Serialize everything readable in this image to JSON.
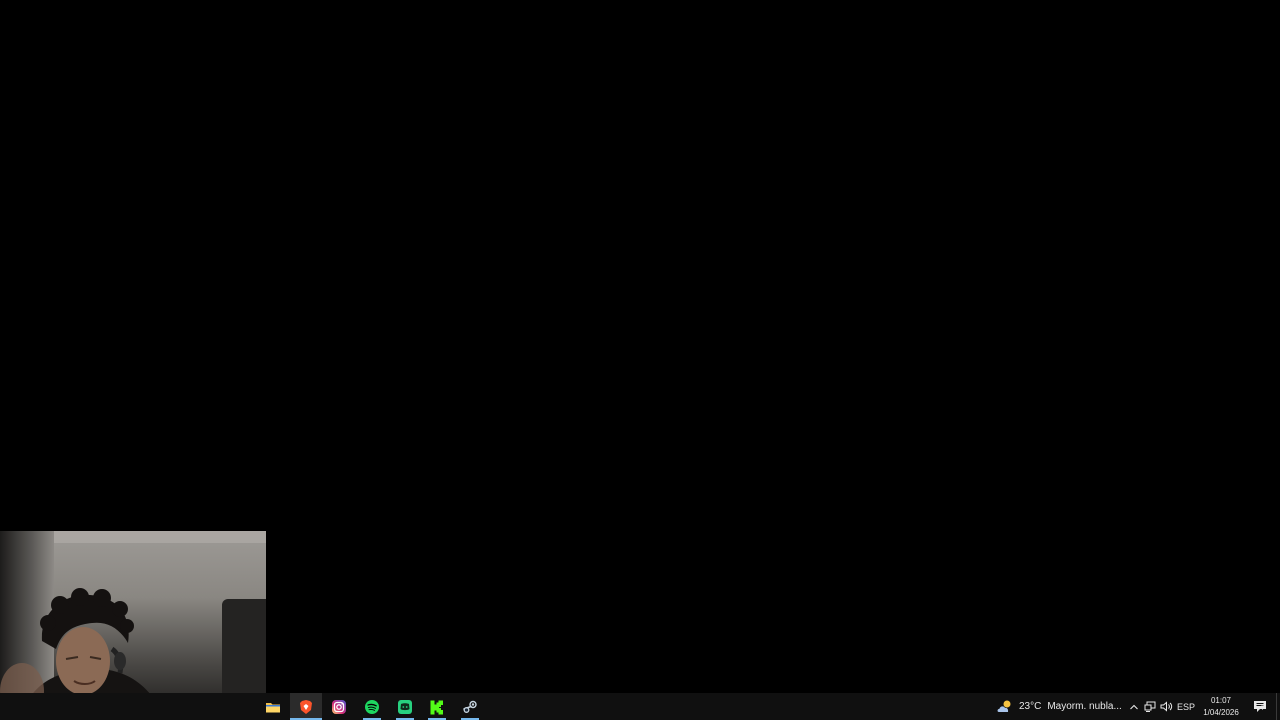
{
  "taskbar": {
    "apps": [
      {
        "name": "File Explorer",
        "icon": "folder-icon",
        "color": "#f3c04b"
      },
      {
        "name": "Brave",
        "icon": "brave-icon",
        "color": "#fb542b"
      },
      {
        "name": "Instagram",
        "icon": "instagram-icon",
        "color": "#d6249f"
      },
      {
        "name": "Spotify",
        "icon": "spotify-icon",
        "color": "#1ed760"
      },
      {
        "name": "Discord",
        "icon": "discord-icon",
        "color": "#27d17f"
      },
      {
        "name": "Kick",
        "icon": "kick-icon",
        "color": "#53fc18"
      },
      {
        "name": "Steam",
        "icon": "steam-icon",
        "color": "#66c0f4"
      }
    ],
    "weather": {
      "temp": "23°C",
      "condition": "Mayorm. nubla...",
      "icon": "partly-cloudy-icon"
    },
    "language": "ESP",
    "time": "01:07",
    "date": "1/04/2026",
    "notification_count": "7",
    "accent": "#76b9ed"
  }
}
